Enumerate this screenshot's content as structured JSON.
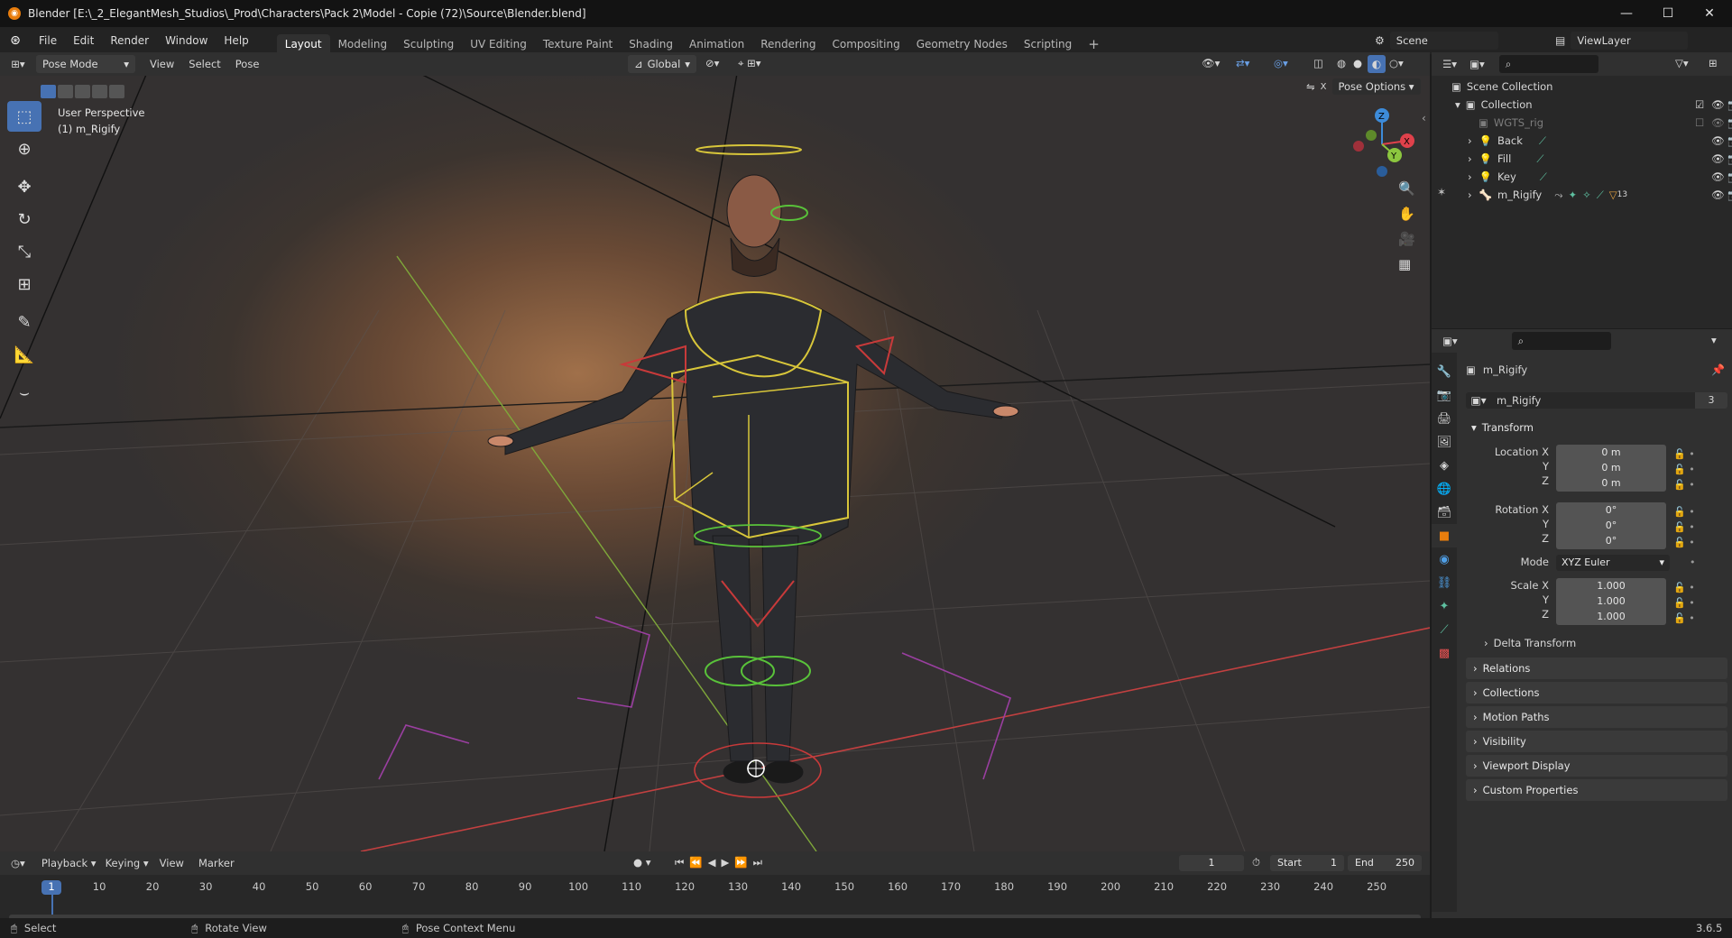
{
  "title": "Blender [E:\\_2_ElegantMesh_Studios\\_Prod\\Characters\\Pack 2\\Model - Copie (72)\\Source\\Blender.blend]",
  "menus": [
    "File",
    "Edit",
    "Render",
    "Window",
    "Help"
  ],
  "workspaces": [
    "Layout",
    "Modeling",
    "Sculpting",
    "UV Editing",
    "Texture Paint",
    "Shading",
    "Animation",
    "Rendering",
    "Compositing",
    "Geometry Nodes",
    "Scripting"
  ],
  "active_workspace": "Layout",
  "scene": "Scene",
  "view_layer": "ViewLayer",
  "viewport": {
    "mode": "Pose Mode",
    "header_menus": [
      "View",
      "Select",
      "Pose"
    ],
    "orientation": "Global",
    "pose_options": "Pose Options",
    "overlay_text": [
      "User Perspective",
      "(1) m_Rigify"
    ],
    "gizmo": {
      "x": "X",
      "y": "Y",
      "z": "Z"
    }
  },
  "outliner": {
    "root": "Scene Collection",
    "collection": "Collection",
    "items": [
      {
        "name": "WGTS_rig",
        "dim": true
      },
      {
        "name": "Back"
      },
      {
        "name": "Fill"
      },
      {
        "name": "Key"
      },
      {
        "name": "m_Rigify",
        "extra": "13"
      }
    ]
  },
  "properties": {
    "object_name": "m_Rigify",
    "data_name": "m_Rigify",
    "users": "3",
    "transform_label": "Transform",
    "location_label": "Location X",
    "rotation_label": "Rotation X",
    "scale_label": "Scale X",
    "axis_labels": [
      "Y",
      "Z"
    ],
    "location": [
      "0 m",
      "0 m",
      "0 m"
    ],
    "rotation": [
      "0°",
      "0°",
      "0°"
    ],
    "mode_label": "Mode",
    "mode": "XYZ Euler",
    "scale": [
      "1.000",
      "1.000",
      "1.000"
    ],
    "delta": "Delta Transform",
    "panels": [
      "Relations",
      "Collections",
      "Motion Paths",
      "Visibility",
      "Viewport Display",
      "Custom Properties"
    ]
  },
  "timeline": {
    "menus": [
      "Playback",
      "Keying",
      "View",
      "Marker"
    ],
    "current_frame": "1",
    "start_label": "Start",
    "start": "1",
    "end_label": "End",
    "end": "250",
    "ticks": [
      "1",
      "10",
      "20",
      "30",
      "40",
      "50",
      "60",
      "70",
      "80",
      "90",
      "100",
      "110",
      "120",
      "130",
      "140",
      "150",
      "160",
      "170",
      "180",
      "190",
      "200",
      "210",
      "220",
      "230",
      "240",
      "250"
    ]
  },
  "status": {
    "items": [
      "Select",
      "Rotate View",
      "Pose Context Menu"
    ],
    "version": "3.6.5"
  },
  "colors": {
    "accent": "#4772b3",
    "orange": "#e87d0d",
    "x_axis": "#e0414b",
    "y_axis": "#8cc63f",
    "z_axis": "#3d8bd9"
  }
}
